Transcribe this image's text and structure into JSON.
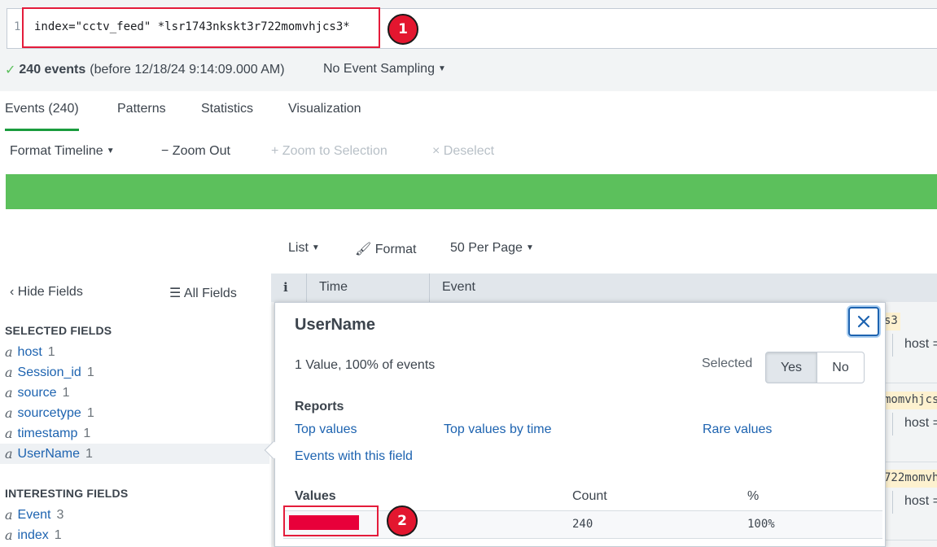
{
  "search": {
    "line_number": "1",
    "query": "index=\"cctv_feed\" *lsr1743nkskt3r722momvhjcs3*"
  },
  "annotations": {
    "badge_1": "1",
    "badge_2": "2"
  },
  "status": {
    "check": "✓",
    "event_count": "240 events",
    "before_text": "(before 12/18/24 9:14:09.000 AM)",
    "sampling": "No Event Sampling"
  },
  "tabs": [
    {
      "label": "Events (240)",
      "active": true
    },
    {
      "label": "Patterns"
    },
    {
      "label": "Statistics"
    },
    {
      "label": "Visualization"
    }
  ],
  "timeline": {
    "format_timeline": "Format Timeline",
    "zoom_out": "Zoom Out",
    "zoom_to_selection": "Zoom to Selection",
    "deselect": "Deselect",
    "bar_color": "#5cc05c"
  },
  "list_controls": {
    "list": "List",
    "format": "Format",
    "per_page": "50 Per Page"
  },
  "sidebar": {
    "hide_fields": "Hide Fields",
    "all_fields": "All Fields",
    "selected_title": "SELECTED FIELDS",
    "selected_fields": [
      {
        "type": "a",
        "name": "host",
        "count": "1"
      },
      {
        "type": "a",
        "name": "Session_id",
        "count": "1"
      },
      {
        "type": "a",
        "name": "source",
        "count": "1"
      },
      {
        "type": "a",
        "name": "sourcetype",
        "count": "1"
      },
      {
        "type": "a",
        "name": "timestamp",
        "count": "1"
      },
      {
        "type": "a",
        "name": "UserName",
        "count": "1"
      }
    ],
    "interesting_title": "INTERESTING FIELDS",
    "interesting_fields": [
      {
        "type": "a",
        "name": "Event",
        "count": "3"
      },
      {
        "type": "a",
        "name": "index",
        "count": "1"
      }
    ]
  },
  "table": {
    "col_info": "i",
    "col_time": "Time",
    "col_event": "Event",
    "fragments": [
      "s3",
      "momvhjcs",
      "722momvh"
    ],
    "host_label": "host ="
  },
  "popup": {
    "title": "UserName",
    "summary": "1 Value, 100% of events",
    "selected_label": "Selected",
    "yes": "Yes",
    "no": "No",
    "reports_title": "Reports",
    "top_values": "Top values",
    "top_values_by_time": "Top values by time",
    "rare_values": "Rare values",
    "events_with_field": "Events with this field",
    "values_title": "Values",
    "count_header": "Count",
    "pct_header": "%",
    "value_count": "240",
    "value_pct": "100%",
    "redaction_color": "#e8003a"
  },
  "colors": {
    "accent_link": "#1d63b0",
    "highlight_red": "#e41c3b",
    "active_tab_underline": "#1a9c3e"
  }
}
